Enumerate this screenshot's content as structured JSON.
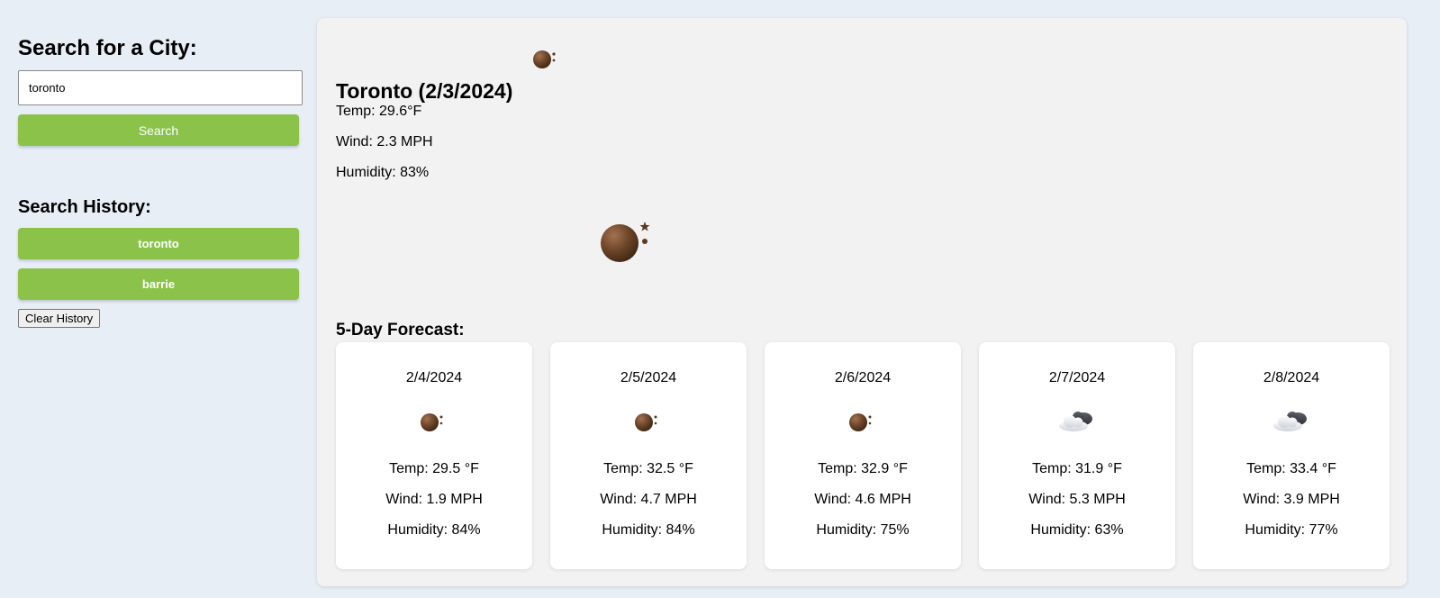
{
  "sidebar": {
    "search_title": "Search for a City:",
    "search_value": "toronto",
    "search_button": "Search",
    "history_title": "Search History:",
    "history": [
      "toronto",
      "barrie"
    ],
    "clear_button": "Clear History"
  },
  "current": {
    "heading": "Toronto (2/3/2024)",
    "icon": "moon-clear-night-icon",
    "temp": "Temp: 29.6°F",
    "wind": "Wind: 2.3 MPH",
    "humidity": "Humidity: 83%"
  },
  "forecast": {
    "title": "5-Day Forecast:",
    "days": [
      {
        "date": "2/4/2024",
        "icon": "moon-clear-night-icon",
        "temp": "Temp: 29.5 °F",
        "wind": "Wind: 1.9 MPH",
        "humidity": "Humidity: 84%"
      },
      {
        "date": "2/5/2024",
        "icon": "moon-clear-night-icon",
        "temp": "Temp: 32.5 °F",
        "wind": "Wind: 4.7 MPH",
        "humidity": "Humidity: 84%"
      },
      {
        "date": "2/6/2024",
        "icon": "moon-clear-night-icon",
        "temp": "Temp: 32.9 °F",
        "wind": "Wind: 4.6 MPH",
        "humidity": "Humidity: 75%"
      },
      {
        "date": "2/7/2024",
        "icon": "cloudy-night-icon",
        "temp": "Temp: 31.9 °F",
        "wind": "Wind: 5.3 MPH",
        "humidity": "Humidity: 63%"
      },
      {
        "date": "2/8/2024",
        "icon": "cloudy-night-icon",
        "temp": "Temp: 33.4 °F",
        "wind": "Wind: 3.9 MPH",
        "humidity": "Humidity: 77%"
      }
    ]
  },
  "colors": {
    "accent_green": "#8bc34a",
    "page_background": "#e8eef6",
    "panel_background": "#f2f2f2",
    "moon": "#6b4428"
  }
}
